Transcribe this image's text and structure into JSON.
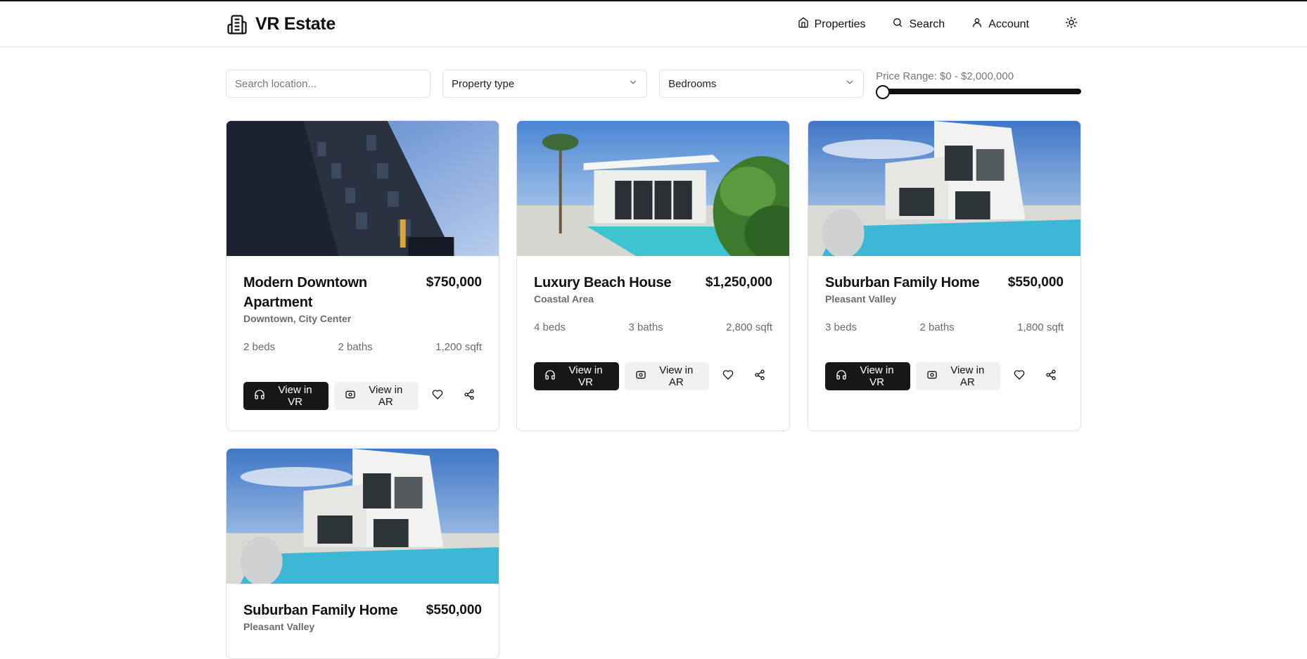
{
  "header": {
    "brand": "VR Estate",
    "nav": [
      {
        "label": "Properties",
        "icon": "home-icon"
      },
      {
        "label": "Search",
        "icon": "search-icon"
      },
      {
        "label": "Account",
        "icon": "user-icon"
      }
    ],
    "theme_icon": "sun-icon"
  },
  "filters": {
    "location_placeholder": "Search location...",
    "property_type": "Property type",
    "bedrooms": "Bedrooms",
    "price_label": "Price Range: $0 - $2,000,000",
    "price_slider_value": 0
  },
  "properties": [
    {
      "title": "Modern Downtown Apartment",
      "price": "$750,000",
      "location": "Downtown, City Center",
      "beds": "2 beds",
      "baths": "2 baths",
      "sqft": "1,200 sqft",
      "image": "apartment-building"
    },
    {
      "title": "Luxury Beach House",
      "price": "$1,250,000",
      "location": "Coastal Area",
      "beds": "4 beds",
      "baths": "3 baths",
      "sqft": "2,800 sqft",
      "image": "beach-house"
    },
    {
      "title": "Suburban Family Home",
      "price": "$550,000",
      "location": "Pleasant Valley",
      "beds": "3 beds",
      "baths": "2 baths",
      "sqft": "1,800 sqft",
      "image": "pool-villa"
    },
    {
      "title": "Suburban Family Home",
      "price": "$550,000",
      "location": "Pleasant Valley",
      "image": "pool-villa"
    }
  ],
  "actions": {
    "vr_label": "View in VR",
    "ar_label": "View in AR"
  },
  "colors": {
    "primary_button": "#171717",
    "secondary_button": "#f1f1f1",
    "muted_text": "#6b6b6b",
    "border": "#e2e2e2"
  }
}
